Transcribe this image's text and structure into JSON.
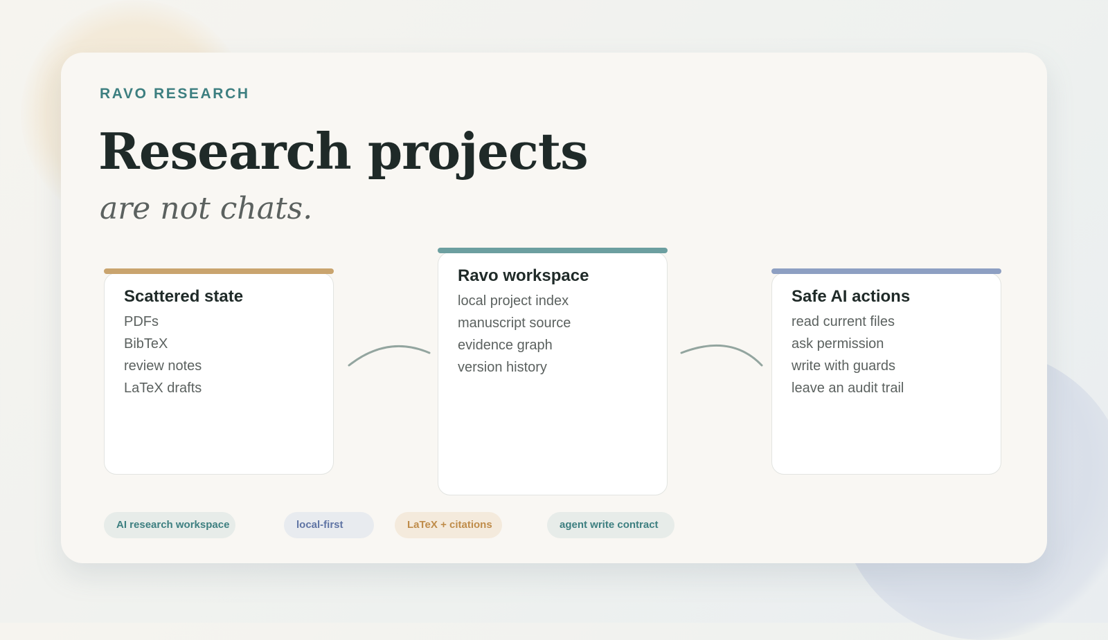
{
  "brand": "RAVO RESEARCH",
  "headline": "Research projects",
  "subheadline": "are not chats.",
  "panels": [
    {
      "title": "Scattered state",
      "items": [
        "PDFs",
        "BibTeX",
        "review notes",
        "LaTeX drafts"
      ],
      "accent": "#c9a46e"
    },
    {
      "title": "Ravo workspace",
      "items": [
        "local project index",
        "manuscript source",
        "evidence graph",
        "version history"
      ],
      "accent": "#6c9fa0"
    },
    {
      "title": "Safe AI actions",
      "items": [
        "read current files",
        "ask permission",
        "write with guards",
        "leave an audit trail"
      ],
      "accent": "#8d9fc2"
    }
  ],
  "tags": [
    {
      "label": "AI research workspace",
      "bg": "#e7ece9",
      "color": "#3d7f80"
    },
    {
      "label": "local-first",
      "bg": "#e8ebef",
      "color": "#5f74a4"
    },
    {
      "label": "LaTeX + citations",
      "bg": "#f4eadc",
      "color": "#bf8c4a"
    },
    {
      "label": "agent write contract",
      "bg": "#e7ece9",
      "color": "#3d7f80"
    }
  ]
}
